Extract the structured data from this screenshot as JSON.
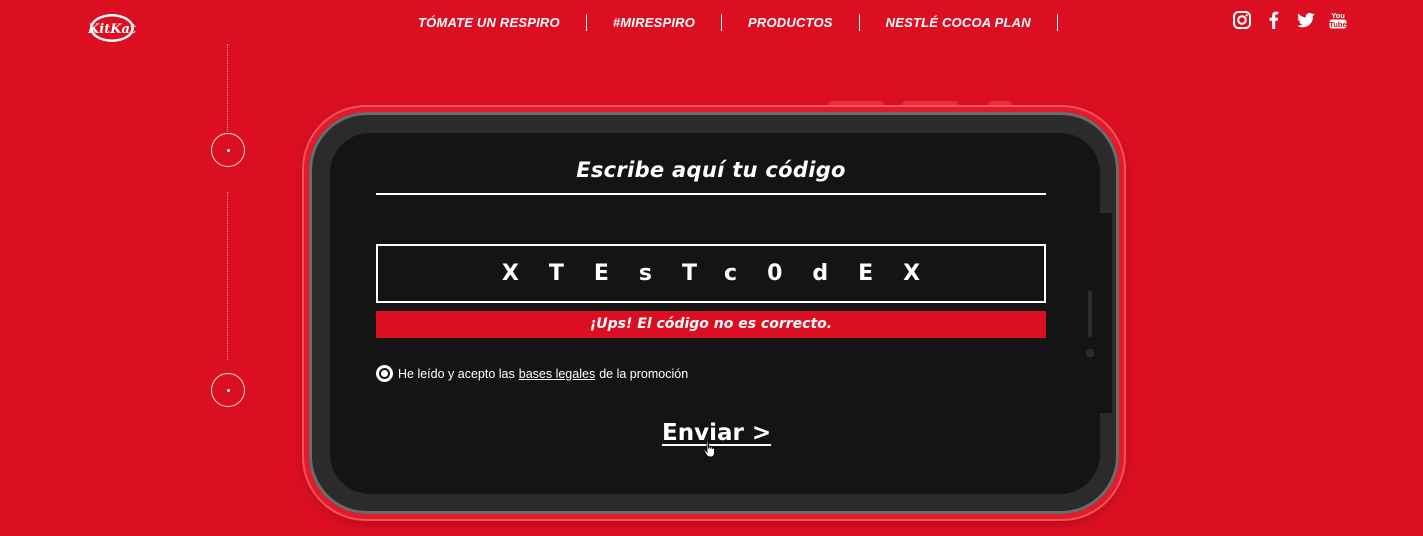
{
  "brand": {
    "logo_text": "KitKat",
    "logo_color": "#dc0f22"
  },
  "nav": {
    "items": [
      {
        "label": "TÓMATE UN RESPIRO"
      },
      {
        "label": "#MIRESPIRO"
      },
      {
        "label": "PRODUCTOS"
      },
      {
        "label": "NESTLÉ COCOA PLAN"
      }
    ]
  },
  "social": {
    "icons": [
      "instagram-icon",
      "facebook-icon",
      "twitter-icon",
      "youtube-icon"
    ],
    "youtube_text_top": "You",
    "youtube_text_bottom": "Tube"
  },
  "form": {
    "title": "Escribe aquí tu código",
    "code_value": "XTEsTc0dEX",
    "error_message": "¡Ups! El código no es correcto.",
    "consent_prefix": "He leído y acepto las",
    "consent_link": "bases legales",
    "consent_suffix": "de la promoción",
    "consent_checked": true,
    "submit_label": "Enviar >"
  },
  "colors": {
    "background": "#dc0f22",
    "screen": "#141414",
    "text": "#ffffff"
  }
}
